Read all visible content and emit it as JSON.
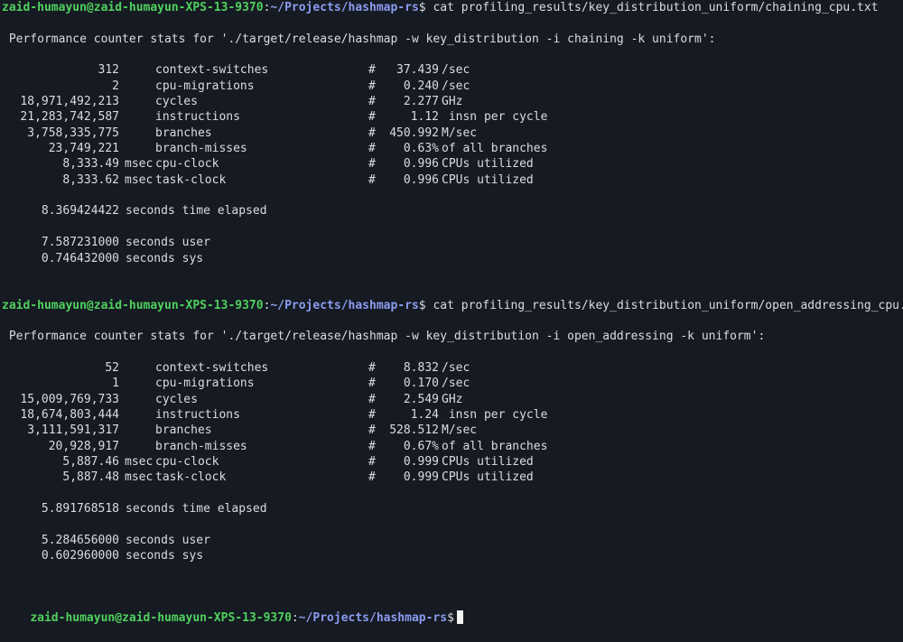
{
  "prompt": {
    "user_host": "zaid-humayun@zaid-humayun-XPS-13-9370",
    "colon": ":",
    "path": "~/Projects/hashmap-rs",
    "symbol": "$"
  },
  "colors": {
    "background": "#161a22",
    "user_host": "#4fd15e",
    "path": "#8a9cf0",
    "text": "#d9dde3",
    "cursor": "#f2f2f2"
  },
  "blocks": [
    {
      "command": "cat profiling_results/key_distribution_uniform/chaining_cpu.txt",
      "header": " Performance counter stats for './target/release/hashmap -w key_distribution -i chaining -k uniform':",
      "stats": [
        {
          "value": "312",
          "unit": "",
          "event": "context-switches",
          "metric": "37.439",
          "desc": "/sec"
        },
        {
          "value": "2",
          "unit": "",
          "event": "cpu-migrations",
          "metric": "0.240",
          "desc": "/sec"
        },
        {
          "value": "18,971,492,213",
          "unit": "",
          "event": "cycles",
          "metric": "2.277",
          "desc": "GHz"
        },
        {
          "value": "21,283,742,587",
          "unit": "",
          "event": "instructions",
          "metric": "1.12",
          "desc": " insn per cycle"
        },
        {
          "value": "3,758,335,775",
          "unit": "",
          "event": "branches",
          "metric": "450.992",
          "desc": "M/sec"
        },
        {
          "value": "23,749,221",
          "unit": "",
          "event": "branch-misses",
          "metric": "0.63%",
          "desc": "of all branches"
        },
        {
          "value": "8,333.49",
          "unit": "msec",
          "event": "cpu-clock",
          "metric": "0.996",
          "desc": "CPUs utilized"
        },
        {
          "value": "8,333.62",
          "unit": "msec",
          "event": "task-clock",
          "metric": "0.996",
          "desc": "CPUs utilized"
        }
      ],
      "elapsed": {
        "value": "8.369424422",
        "label": "seconds time elapsed"
      },
      "user": {
        "value": "7.587231000",
        "label": "seconds user"
      },
      "sys": {
        "value": "0.746432000",
        "label": "seconds sys"
      }
    },
    {
      "command": "cat profiling_results/key_distribution_uniform/open_addressing_cpu.txt",
      "header": " Performance counter stats for './target/release/hashmap -w key_distribution -i open_addressing -k uniform':",
      "stats": [
        {
          "value": "52",
          "unit": "",
          "event": "context-switches",
          "metric": "8.832",
          "desc": "/sec"
        },
        {
          "value": "1",
          "unit": "",
          "event": "cpu-migrations",
          "metric": "0.170",
          "desc": "/sec"
        },
        {
          "value": "15,009,769,733",
          "unit": "",
          "event": "cycles",
          "metric": "2.549",
          "desc": "GHz"
        },
        {
          "value": "18,674,803,444",
          "unit": "",
          "event": "instructions",
          "metric": "1.24",
          "desc": " insn per cycle"
        },
        {
          "value": "3,111,591,317",
          "unit": "",
          "event": "branches",
          "metric": "528.512",
          "desc": "M/sec"
        },
        {
          "value": "20,928,917",
          "unit": "",
          "event": "branch-misses",
          "metric": "0.67%",
          "desc": "of all branches"
        },
        {
          "value": "5,887.46",
          "unit": "msec",
          "event": "cpu-clock",
          "metric": "0.999",
          "desc": "CPUs utilized"
        },
        {
          "value": "5,887.48",
          "unit": "msec",
          "event": "task-clock",
          "metric": "0.999",
          "desc": "CPUs utilized"
        }
      ],
      "elapsed": {
        "value": "5.891768518",
        "label": "seconds time elapsed"
      },
      "user": {
        "value": "5.284656000",
        "label": "seconds user"
      },
      "sys": {
        "value": "0.602960000",
        "label": "seconds sys"
      }
    }
  ],
  "hash_symbol": "#"
}
